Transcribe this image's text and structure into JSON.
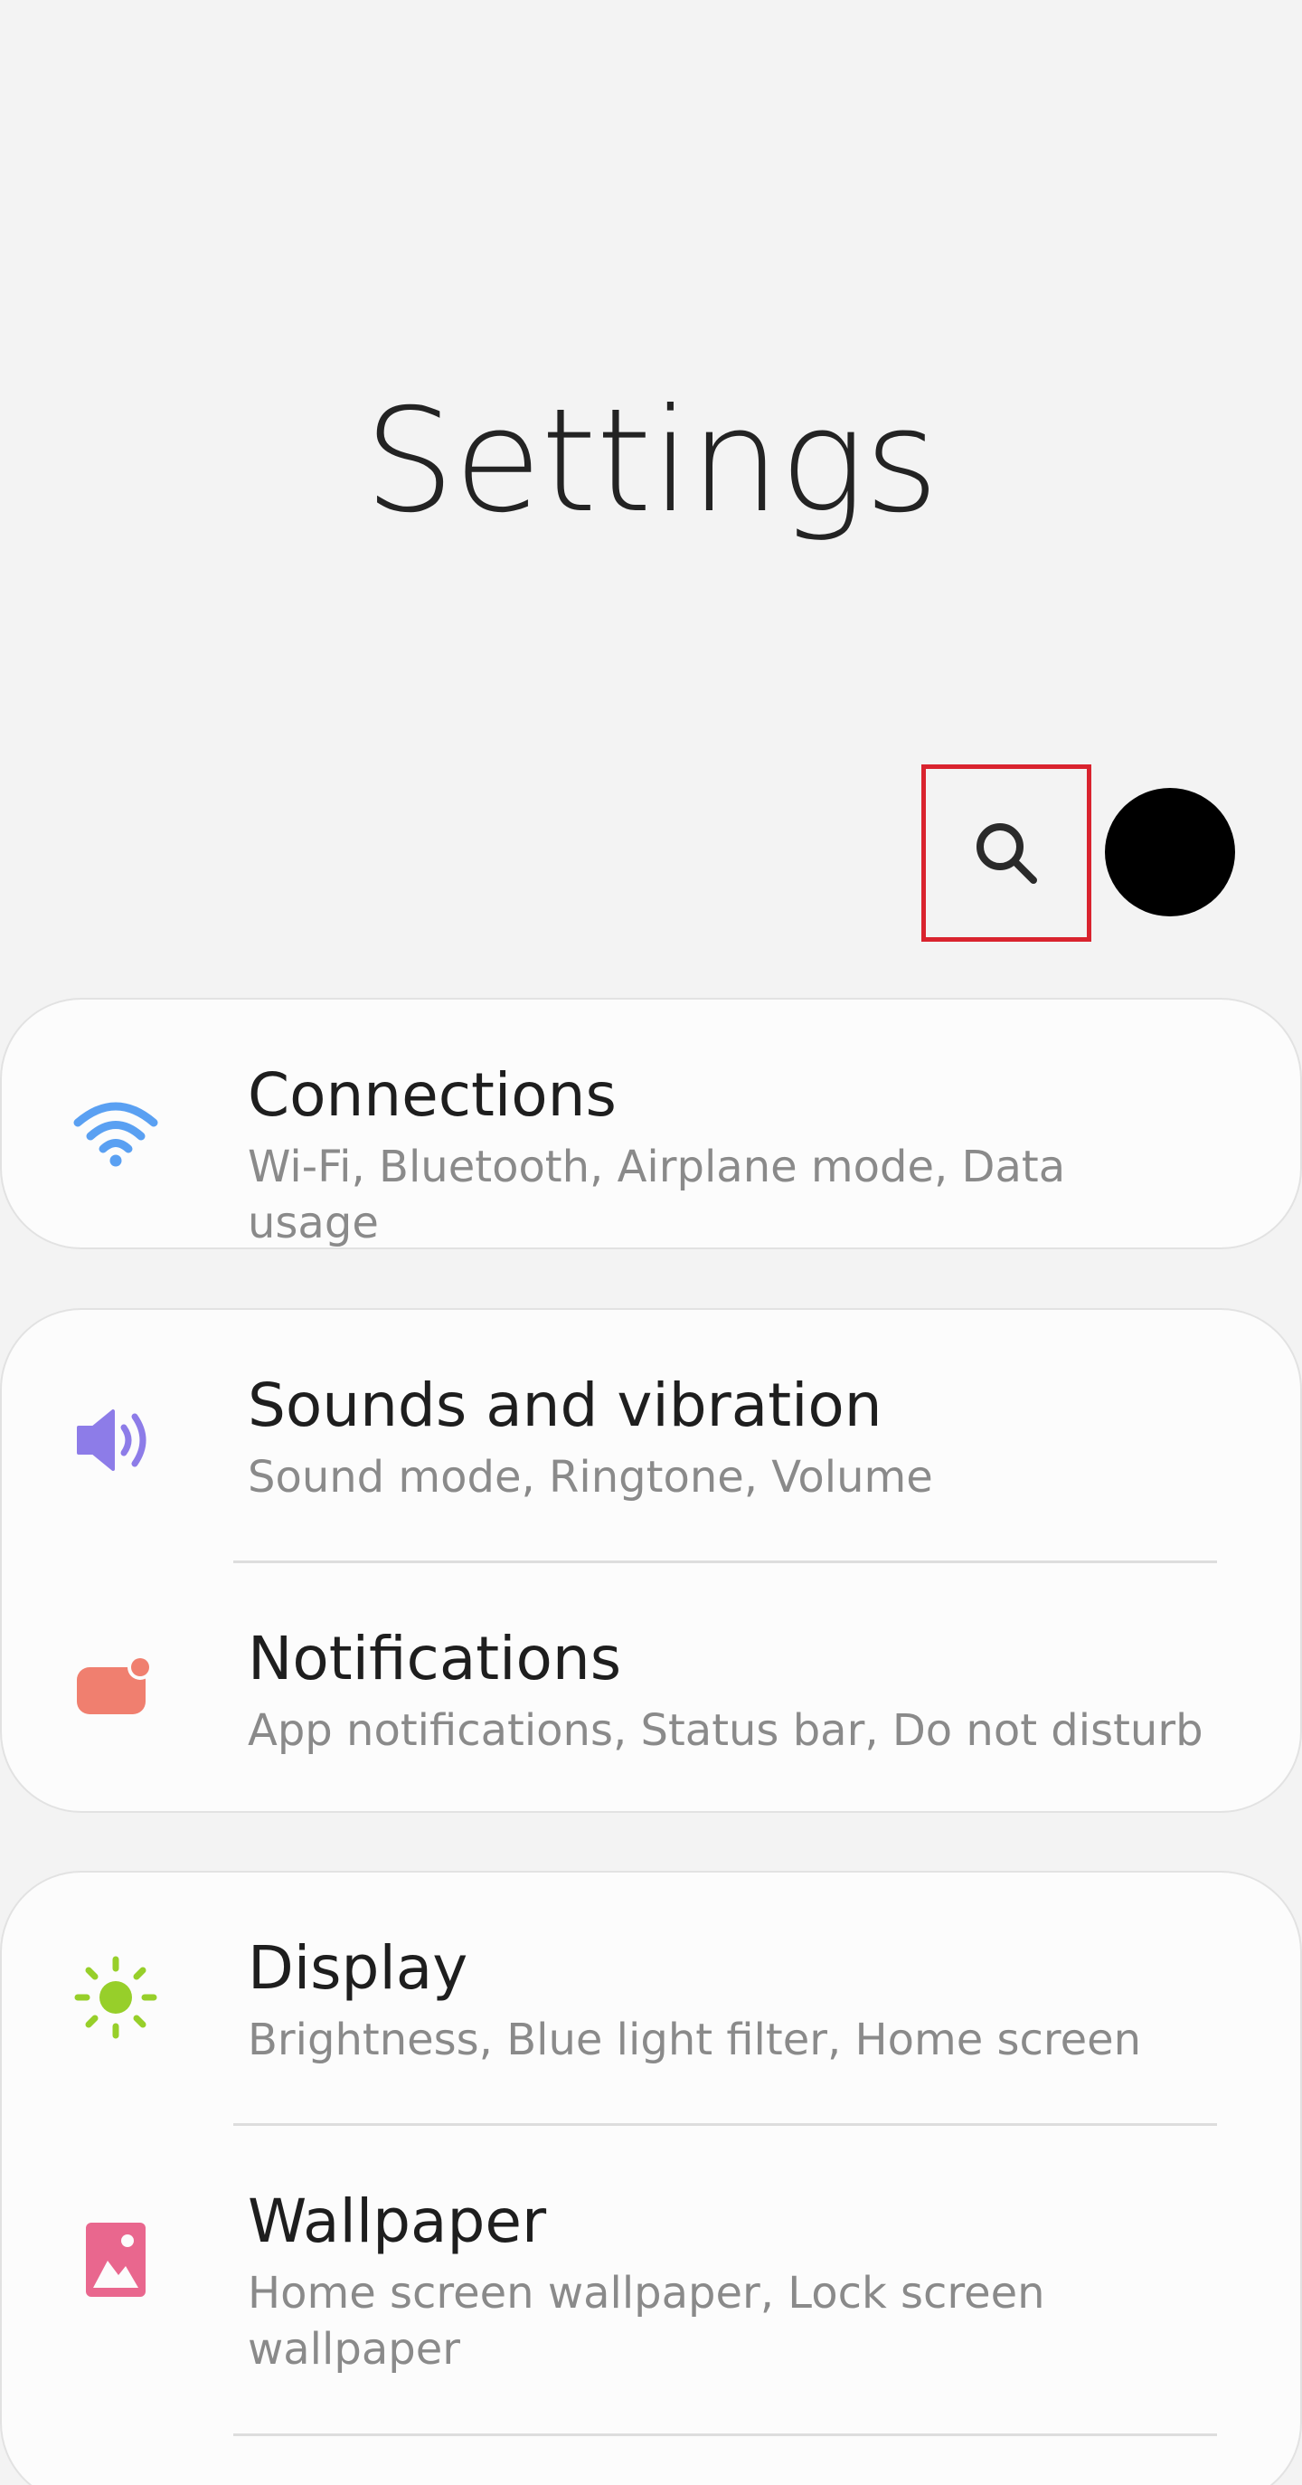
{
  "header": {
    "title": "Settings"
  },
  "toolbar": {
    "search_icon": "search-icon",
    "avatar": "profile-avatar"
  },
  "colors": {
    "background": "#f3f3f3",
    "card": "#fcfcfc",
    "highlight": "#d9232e",
    "connections_icon": "#5aa0f2",
    "sounds_icon": "#8d7ce8",
    "notifications_icon": "#f07f6f",
    "display_icon": "#97cf2a",
    "wallpaper_icon": "#e9678e"
  },
  "settings": [
    {
      "label": "Connections",
      "sub": "Wi-Fi, Bluetooth, Airplane mode, Data usage",
      "icon": "wifi-icon"
    },
    {
      "label": "Sounds and vibration",
      "sub": "Sound mode, Ringtone, Volume",
      "icon": "speaker-icon"
    },
    {
      "label": "Notifications",
      "sub": "App notifications, Status bar, Do not disturb",
      "icon": "notification-icon"
    },
    {
      "label": "Display",
      "sub": "Brightness, Blue light filter, Home screen",
      "icon": "sun-icon"
    },
    {
      "label": "Wallpaper",
      "sub": "Home screen wallpaper, Lock screen wallpaper",
      "icon": "wallpaper-icon"
    }
  ]
}
